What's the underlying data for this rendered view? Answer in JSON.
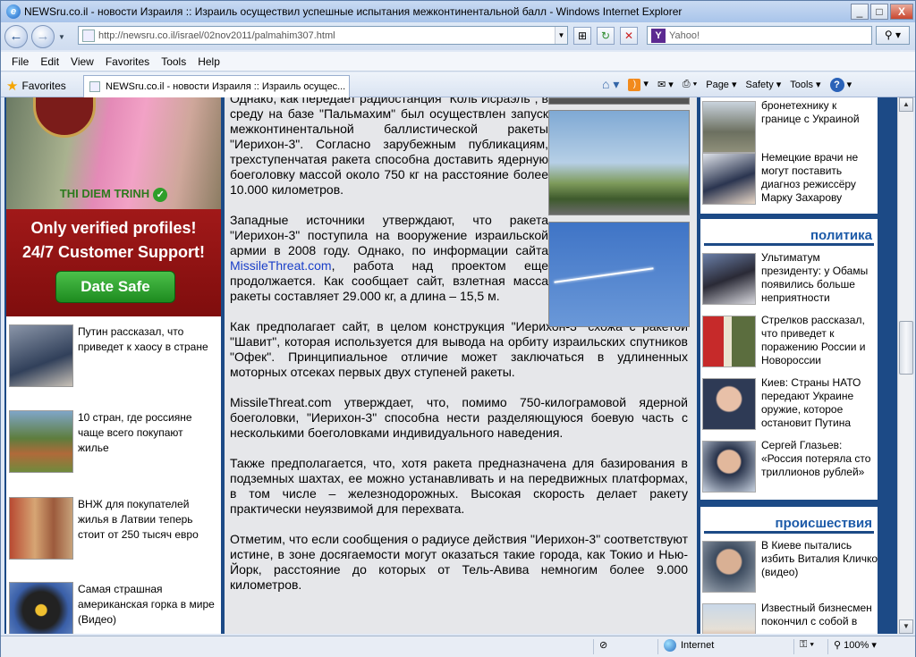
{
  "window": {
    "title": "NEWSru.co.il - новости Израиля :: Израиль осуществил успешные испытания межконтинентальной балл - Windows Internet Explorer",
    "minimize": "_",
    "maximize": "□",
    "close": "X"
  },
  "address": {
    "url": "http://newsru.co.il/israel/02nov2011/palmahim307.html",
    "search_placeholder": "Yahoo!",
    "search_logo": "Y"
  },
  "menu": [
    "File",
    "Edit",
    "View",
    "Favorites",
    "Tools",
    "Help"
  ],
  "favorites_label": "Favorites",
  "tab_label": "NEWSru.co.il - новости Израиля :: Израиль осущес...",
  "commands": {
    "page": "Page",
    "safety": "Safety",
    "tools": "Tools"
  },
  "ad": {
    "name": "THI DIEM TRINH",
    "line1": "Only verified profiles!",
    "line2": "24/7 Customer Support!",
    "button": "Date Safe"
  },
  "left_news": [
    "Путин рассказал, что приведет к хаосу в стране",
    "10 стран, где россияне чаще всего покупают жилье",
    "ВНЖ для покупателей жилья в Латвии теперь стоит от 250 тысяч евро",
    "Самая страшная американская горка в мире (Видео)"
  ],
  "article": {
    "p1": "Однако, как передает радиостанция \"Коль Исраэль\", в среду на базе \"Пальмахим\" был осуществлен запуск межконтинентальной баллистической ракеты \"Иерихон-3\". Согласно зарубежным публикациям, трехступенчатая ракета способна доставить ядерную боеголовку массой около 750 кг на расстояние более 10.000 километров.",
    "p2_a": "Западные источники утверждают, что ракета \"Иерихон-3\" поступила на вооружение израильской армии в 2008 году. Однако, по информации сайта ",
    "p2_link": "MissileThreat.com",
    "p2_b": ", работа над проектом еще продолжается. Как сообщает сайт, взлетная масса ракеты составляет 29.000 кг, а длина – 15,5 м.",
    "p3": "Как предполагает сайт, в целом конструкция \"Иерихон-3\" схожа с ракетой \"Шавит\", которая используется для вывода на орбиту израильских спутников \"Офек\". Принципиальное отличие может заключаться в удлиненных моторных отсеках первых двух ступеней ракеты.",
    "p4": "MissileThreat.com утверждает, что, помимо 750-килограмовой ядерной боеголовки, \"Иерихон-3\" способна нести разделяющуюся боевую часть с несколькими боеголовками индивидуального наведения.",
    "p5": "Также предполагается, что, хотя ракета предназначена для базирования в подземных шахтах, ее можно устанавливать и на передвижных платформах, в том числе – железнодорожных. Высокая скорость делает ракету практически неуязвимой для перехвата.",
    "p6": "Отметим, что если сообщения о радиусе действия \"Иерихон-3\" соответствуют истине, в зоне досягаемости могут оказаться такие города, как Токио и Нью-Йорк, расстояние до которых от Тель-Авива немногим более 9.000 километров."
  },
  "right": {
    "top_items": [
      "бронетехнику к границе с Украиной",
      "Немецкие врачи не могут поставить диагноз режиссёру Марку Захарову"
    ],
    "politics_title": "политика",
    "politics": [
      "Ультиматум президенту: у Обамы появились больше неприятности",
      "Стрелков рассказал, что приведет к поражению России и Новороссии",
      "Киев: Страны НАТО передают Украине оружие, которое остановит Путина",
      "Сергей Глазьев: «Россия потеряла сто триллионов рублей»"
    ],
    "incidents_title": "происшествия",
    "incidents": [
      "В Киеве пытались избить Виталия Кличко (видео)",
      "Известный бизнесмен покончил с собой в"
    ]
  },
  "status": {
    "zone": "Internet",
    "zoom": "100%"
  }
}
